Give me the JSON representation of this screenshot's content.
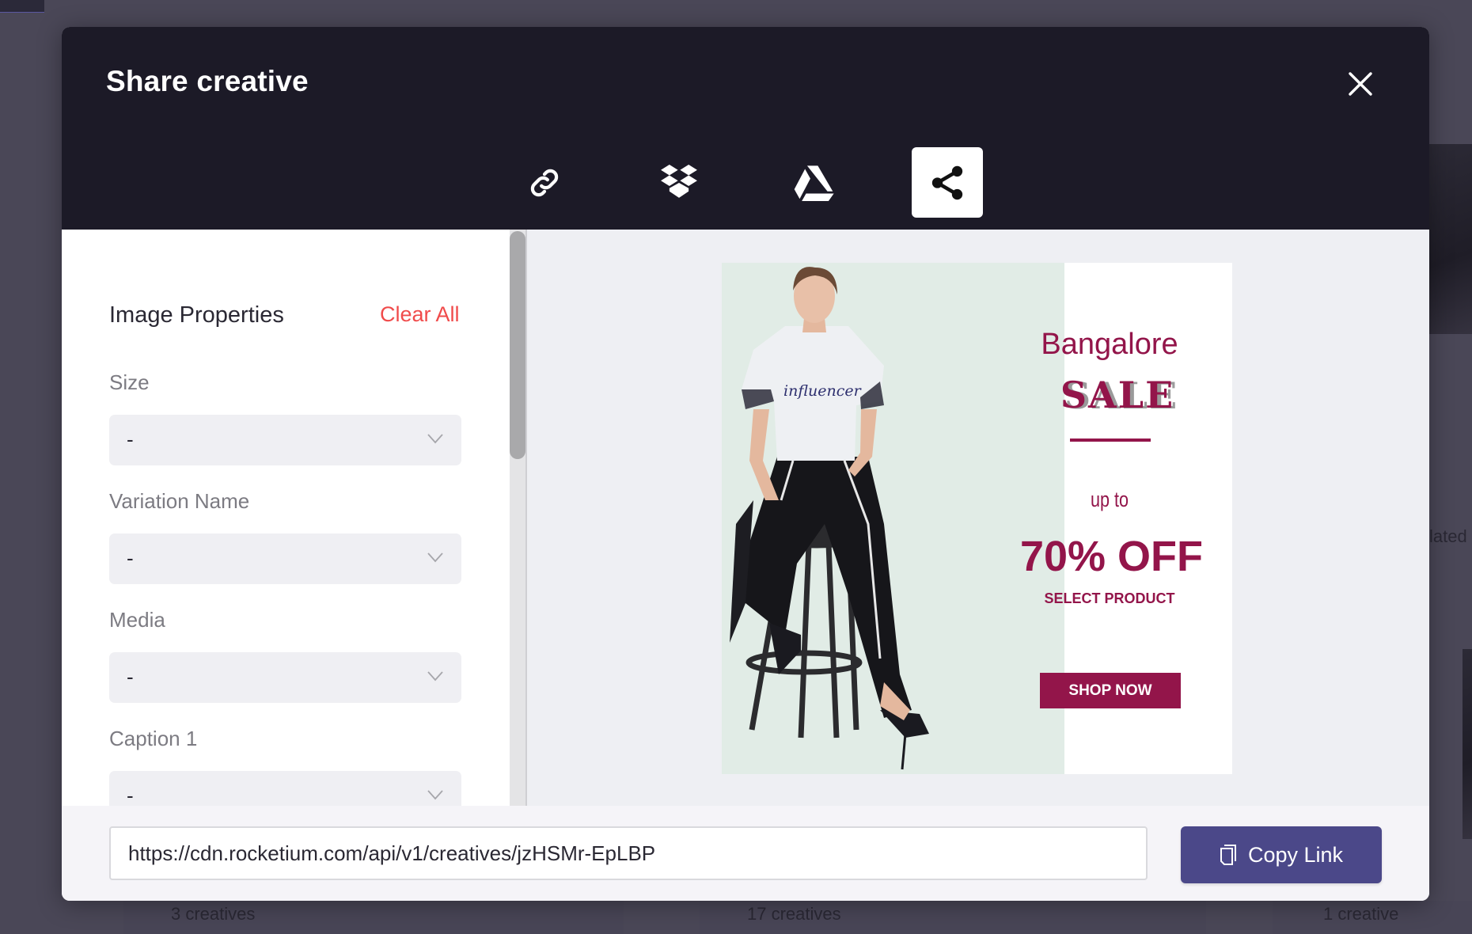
{
  "background": {
    "cards": [
      {
        "count_label": "3 creatives"
      },
      {
        "count_label": "17 creatives"
      },
      {
        "count_label": "1 creative"
      }
    ],
    "partial_text": "lated"
  },
  "modal": {
    "title": "Share creative",
    "close_icon": "close-icon",
    "tabs": [
      {
        "name": "link",
        "icon": "link-icon",
        "active": false
      },
      {
        "name": "dropbox",
        "icon": "dropbox-icon",
        "active": false
      },
      {
        "name": "google-drive",
        "icon": "google-drive-icon",
        "active": false
      },
      {
        "name": "share",
        "icon": "share-icon",
        "active": true
      }
    ],
    "properties": {
      "title": "Image Properties",
      "clear_all": "Clear All",
      "fields": [
        {
          "label": "Size",
          "value": "-"
        },
        {
          "label": "Variation Name",
          "value": "-"
        },
        {
          "label": "Media",
          "value": "-"
        },
        {
          "label": "Caption 1",
          "value": "-"
        }
      ]
    },
    "creative": {
      "shirt_text": "influencer",
      "headline": "Bangalore",
      "sale": "SALE",
      "upto": "up to",
      "discount": "70% OFF",
      "subline": "SELECT PRODUCT",
      "cta": "SHOP NOW",
      "brand_color": "#93154a",
      "panel_color": "#e1ece6"
    },
    "footer": {
      "link_value": "https://cdn.rocketium.com/api/v1/creatives/jzHSMr-EpLBP",
      "copy_label": "Copy Link",
      "button_color": "#4b4889"
    }
  }
}
